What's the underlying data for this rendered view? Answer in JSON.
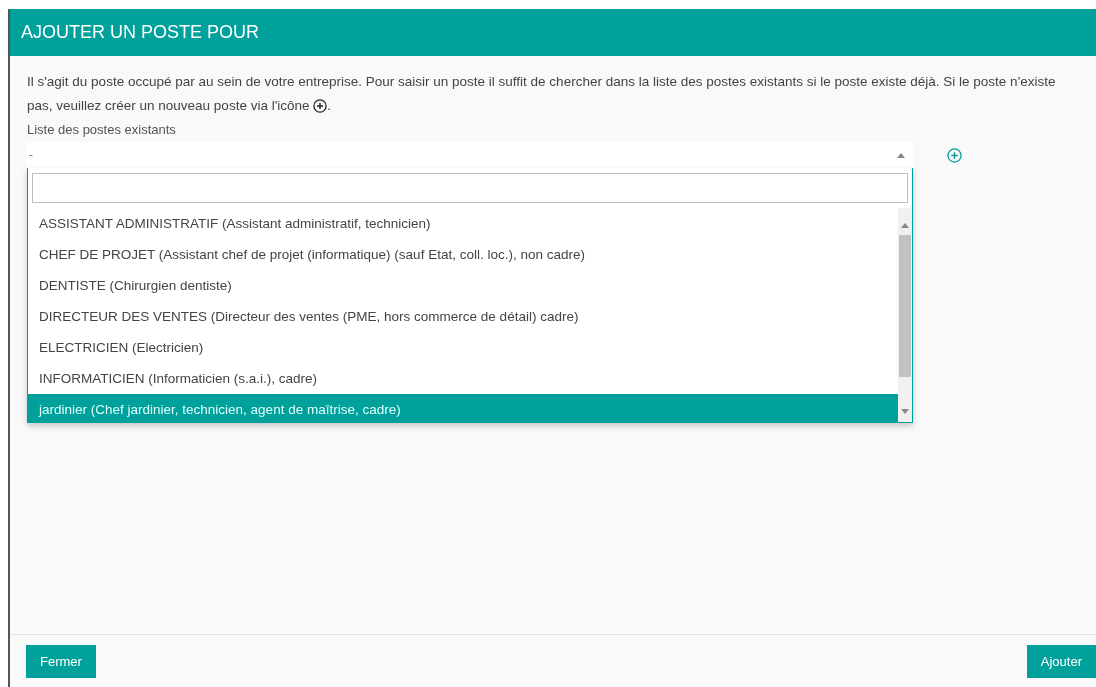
{
  "dialog": {
    "title": "AJOUTER UN POSTE POUR",
    "description_line_1": "Il s'agit du poste occupé par au sein de votre entreprise. Pour saisir un poste il suffit de chercher dans la liste des postes existants si le poste existe déjà. Si le poste n'existe",
    "description_line_2": "pas, veuillez créer un nouveau poste via l'icône",
    "description_end": ".",
    "field_label": "Liste des postes existants",
    "select": {
      "value": "-",
      "expanded": true
    },
    "options": [
      {
        "label": "ASSISTANT ADMINISTRATIF (Assistant administratif, technicien)",
        "selected": false
      },
      {
        "label": "CHEF DE PROJET (Assistant chef de projet (informatique) (sauf Etat, coll. loc.), non cadre)",
        "selected": false
      },
      {
        "label": "DENTISTE (Chirurgien dentiste)",
        "selected": false
      },
      {
        "label": "DIRECTEUR DES VENTES (Directeur des ventes (PME, hors commerce de détail) cadre)",
        "selected": false
      },
      {
        "label": "ELECTRICIEN (Electricien)",
        "selected": false
      },
      {
        "label": "INFORMATICIEN (Informaticien (s.a.i.), cadre)",
        "selected": false
      },
      {
        "label": "jardinier (Chef jardinier, technicien, agent de maîtrise, cadre)",
        "selected": true
      }
    ],
    "buttons": {
      "close": "Fermer",
      "add": "Ajouter"
    }
  }
}
